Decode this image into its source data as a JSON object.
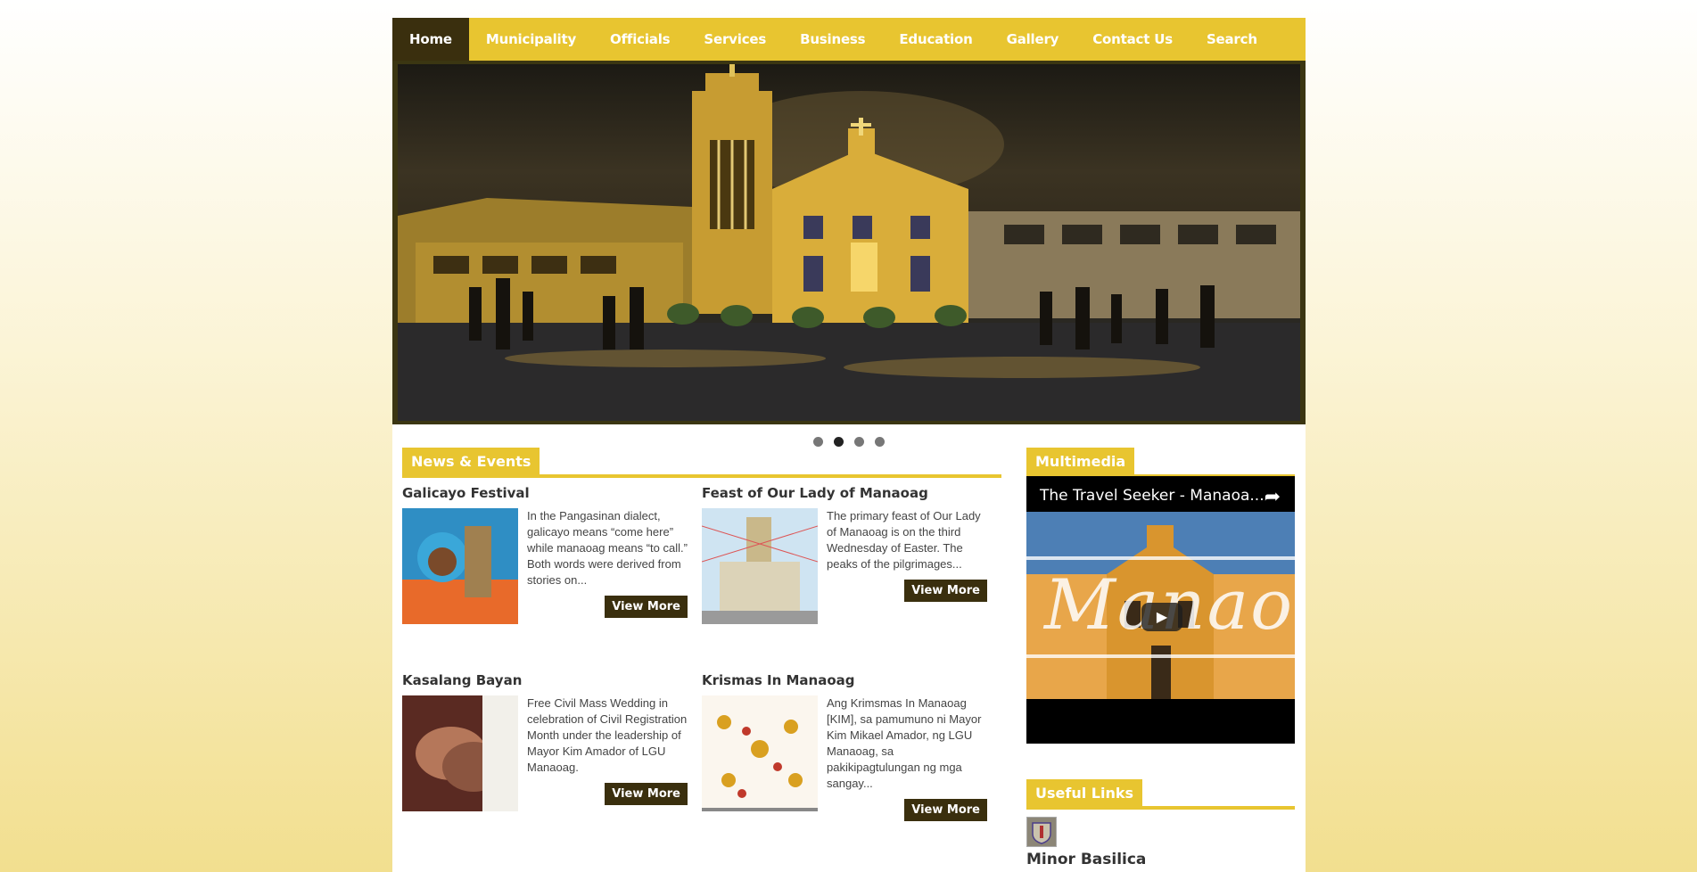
{
  "nav": {
    "items": [
      {
        "label": "Home",
        "active": true
      },
      {
        "label": "Municipality"
      },
      {
        "label": "Officials"
      },
      {
        "label": "Services"
      },
      {
        "label": "Business"
      },
      {
        "label": "Education"
      },
      {
        "label": "Gallery"
      },
      {
        "label": "Contact Us"
      },
      {
        "label": "Search"
      }
    ]
  },
  "slider": {
    "dot_count": 4,
    "active_index": 1
  },
  "news": {
    "heading": "News & Events",
    "items": [
      {
        "title": "Galicayo Festival",
        "text": "In the Pangasinan dialect, galicayo means “come here” while manaoag means “to call.” Both words were derived from stories on...",
        "button": "View More"
      },
      {
        "title": "Feast of Our Lady of Manaoag",
        "text": "The primary feast of Our Lady of Manaoag is on the third Wednesday of Easter. The peaks of the pilgrimages...",
        "button": "View More"
      },
      {
        "title": "Kasalang Bayan",
        "text": "Free Civil Mass Wedding in celebration of Civil Registration Month under the leadership of Mayor Kim Amador of LGU Manaoag.",
        "button": "View More"
      },
      {
        "title": "Krismas In Manaoag",
        "text": "Ang Krimsmas In Manaoag [KIM], sa pamumuno ni Mayor Kim Mikael Amador, ng LGU Manaoag, sa pakikipagtulungan ng mga sangay...",
        "button": "View More"
      }
    ]
  },
  "multimedia": {
    "heading": "Multimedia",
    "video_title": "The Travel Seeker - Manaoa...",
    "overlay_text": "Manaoag"
  },
  "useful_links": {
    "heading": "Useful Links",
    "first_link": "Minor Basilica"
  },
  "colors": {
    "accent": "#e8c530",
    "dark": "#3a2f0e"
  }
}
